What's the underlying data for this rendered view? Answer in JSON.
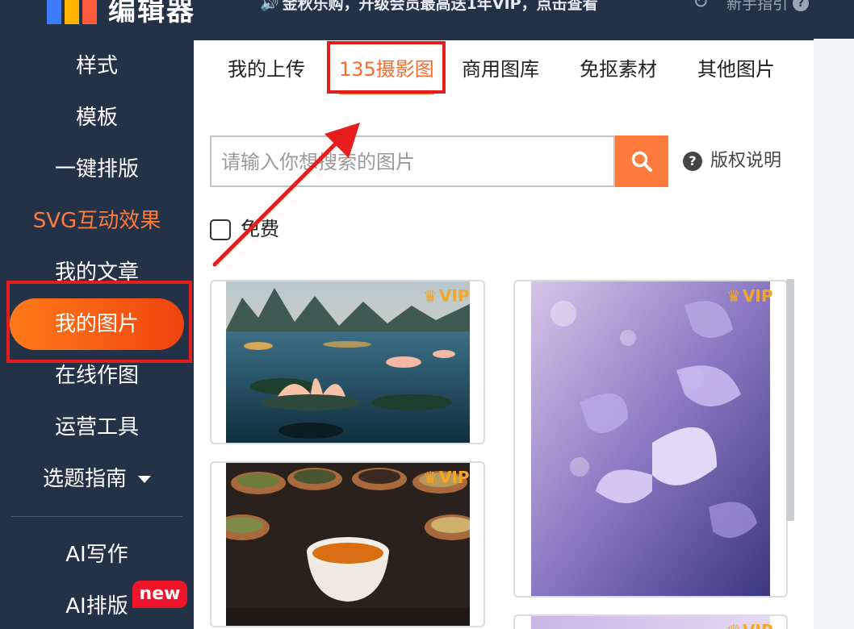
{
  "app": {
    "logo_text": "编辑器",
    "announcement": "金秋乐购，升级会员最高送1年VIP，点击查看",
    "guide_label": "新手指引"
  },
  "sidebar": {
    "items": [
      {
        "label": "样式"
      },
      {
        "label": "模板"
      },
      {
        "label": "一键排版"
      },
      {
        "label": "SVG互动效果"
      },
      {
        "label": "我的文章"
      },
      {
        "label": "我的图片"
      },
      {
        "label": "在线作图"
      },
      {
        "label": "运营工具"
      },
      {
        "label": "选题指南"
      },
      {
        "label": "AI写作"
      },
      {
        "label": "AI排版"
      }
    ],
    "active_index": 5,
    "new_badge": "new"
  },
  "tabs": [
    {
      "label": "我的上传"
    },
    {
      "label": "135摄影图"
    },
    {
      "label": "商用图库"
    },
    {
      "label": "免抠素材"
    },
    {
      "label": "其他图片"
    }
  ],
  "active_tab": 1,
  "search": {
    "placeholder": "请输入你想搜索的图片",
    "value": ""
  },
  "copyright_label": "版权说明",
  "free_filter": {
    "label": "免费",
    "checked": false
  },
  "images": [
    {
      "name": "lotus-lake",
      "badge": "VIP"
    },
    {
      "name": "butterflies-water",
      "badge": "VIP"
    },
    {
      "name": "tea-cups",
      "badge": "VIP"
    },
    {
      "name": "purple-partial",
      "badge": "VIP"
    }
  ],
  "colors": {
    "accent": "#ff7a3d",
    "sidebar_bg": "#243247",
    "highlight_red": "#e51d1d",
    "vip_gold": "#f5a623"
  }
}
